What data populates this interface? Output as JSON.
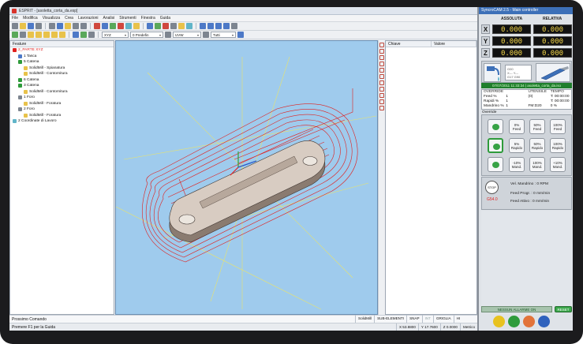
{
  "esprit": {
    "title": "ESPRIT - [asoletta_corta_da.esp]",
    "menu": [
      "File",
      "Modifica",
      "Visualizza",
      "Crea",
      "Lavorazioni",
      "Analisi",
      "Strumenti",
      "Finestra",
      "Guida"
    ],
    "toolbar": {
      "plane": "XYZ",
      "work_plane": "0 Predefin",
      "view": "UVW",
      "filter": "Tutti"
    },
    "tree": {
      "header": "Feature",
      "items": [
        {
          "label": "2_PARTE XYZ",
          "indent": 0,
          "icon": "part-icon"
        },
        {
          "label": "1 Tasca",
          "indent": 1,
          "icon": "pocket-icon"
        },
        {
          "label": "5 Catena",
          "indent": 1,
          "icon": "chain-icon"
        },
        {
          "label": "SolidMill - Spianatura",
          "indent": 2,
          "icon": "mill-op-icon"
        },
        {
          "label": "SolidMill - Contornitura",
          "indent": 2,
          "icon": "mill-op-icon"
        },
        {
          "label": "6 Catena",
          "indent": 1,
          "icon": "chain-icon"
        },
        {
          "label": "3 Catena",
          "indent": 1,
          "icon": "chain-icon"
        },
        {
          "label": "SolidMill - Contornitura",
          "indent": 2,
          "icon": "mill-op-icon"
        },
        {
          "label": "1 Foro",
          "indent": 1,
          "icon": "hole-icon"
        },
        {
          "label": "SolidMill - Foratura",
          "indent": 2,
          "icon": "mill-op-icon"
        },
        {
          "label": "2 Foro",
          "indent": 1,
          "icon": "hole-icon"
        },
        {
          "label": "SolidMill - Foratura",
          "indent": 2,
          "icon": "mill-op-icon"
        },
        {
          "label": "2 Coordinate di Lavoro",
          "indent": 0,
          "icon": "coords-icon"
        }
      ]
    },
    "props": {
      "col1": "Chiave",
      "col2": "Valore"
    },
    "command_label": "Prossimo Comando",
    "status_help": "Premere F1 per la Guida",
    "status_flags": [
      {
        "label": "SolidMill",
        "active": true
      },
      {
        "label": "SUB-ELEMENTI",
        "active": true
      },
      {
        "label": "SNAP",
        "active": true
      },
      {
        "label": "INT",
        "active": false
      },
      {
        "label": "GRIGLIA",
        "active": true
      },
      {
        "label": "HI",
        "active": true
      }
    ],
    "coords": {
      "x": "X 53.8800",
      "y": "Y 17.7600",
      "z": "Z 0.0000",
      "units": "Metrico"
    }
  },
  "syncro": {
    "title": "SyncroCAM 2.5 - Main controller",
    "head_abs": "ASSOLUTA",
    "head_rel": "RELATIVA",
    "axes": [
      {
        "label": "X",
        "abs": "0.000",
        "rel": "0.000"
      },
      {
        "label": "Y",
        "abs": "0.000",
        "rel": "0.000"
      },
      {
        "label": "Z",
        "abs": "0.000",
        "rel": "0.000"
      }
    ],
    "tool_info": [
      "G00",
      "X--- Y---",
      "G17 G90"
    ],
    "program_bar": "07/07/2011 11:33:34 | asoletta_corta_da.iso",
    "override_head": [
      "OVERRIDE",
      "UTENSILE",
      "TEMPO"
    ],
    "override_rows": [
      [
        "Feed %",
        "1",
        "(0)",
        "T: 00:00:00"
      ],
      [
        "Rapidi %",
        "1",
        "",
        "T: 00:00:00"
      ],
      [
        "Mandrino %",
        "1",
        "FM:D20",
        "0 %"
      ]
    ],
    "override_label": "Override",
    "override_buttons": [
      [
        {
          "label": "0%",
          "sub": "Feed"
        },
        {
          "label": "50%",
          "sub": "Feed"
        },
        {
          "label": "100%",
          "sub": "Feed"
        }
      ],
      [
        {
          "label": "5%",
          "sub": "Rapido"
        },
        {
          "label": "50%",
          "sub": "Rapido"
        },
        {
          "label": "100%",
          "sub": "Rapido"
        }
      ],
      [
        {
          "label": "-10%",
          "sub": "Mand."
        },
        {
          "label": "100%",
          "sub": "Mand."
        },
        {
          "label": "+10%",
          "sub": "Mand."
        }
      ]
    ],
    "stop_label": "STOP",
    "gcode": "G54.0",
    "spindle": "Vel. Mandrino : 0 RPM",
    "feed_prog": "Feed Progr. : 0 mm/min",
    "feed_act": "Feed Attivo : 0 mm/min",
    "alarm": "NESSUN ALLARME ON",
    "reset": "RESET",
    "colors": {
      "accent": "#3d70b8",
      "display_bg": "#111111",
      "display_fg": "#f5d84a",
      "ok": "#3aa74a"
    }
  }
}
